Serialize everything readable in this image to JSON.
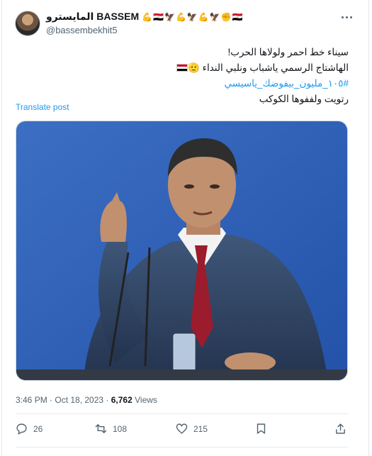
{
  "author": {
    "display_name": "المايسترو BASSEM",
    "emojis": "💪🇪🇬🦅💪🦅💪🦅✊🇪🇬",
    "handle": "@bassembekhit5"
  },
  "tweet": {
    "line1": "سيناء خط احمر ولولاها الحرب!",
    "line2": "الهاشتاج الرسمي ياشباب ونلبي النداء",
    "line2_emoji": "🫡",
    "hashtag": "#١٠٥_مليون_بيفوضك_ياسيسي",
    "line4": "رتويت ولففوها الكوكب"
  },
  "translate_label": "Translate post",
  "timestamp": "3:46 PM · Oct 18, 2023 ·",
  "views": {
    "count": "6,762",
    "label": "Views"
  },
  "actions": {
    "replies": "26",
    "reposts": "108",
    "likes": "215"
  },
  "colors": {
    "accent": "#1d9bf0",
    "muted": "#536471",
    "border": "#cfd9de"
  }
}
